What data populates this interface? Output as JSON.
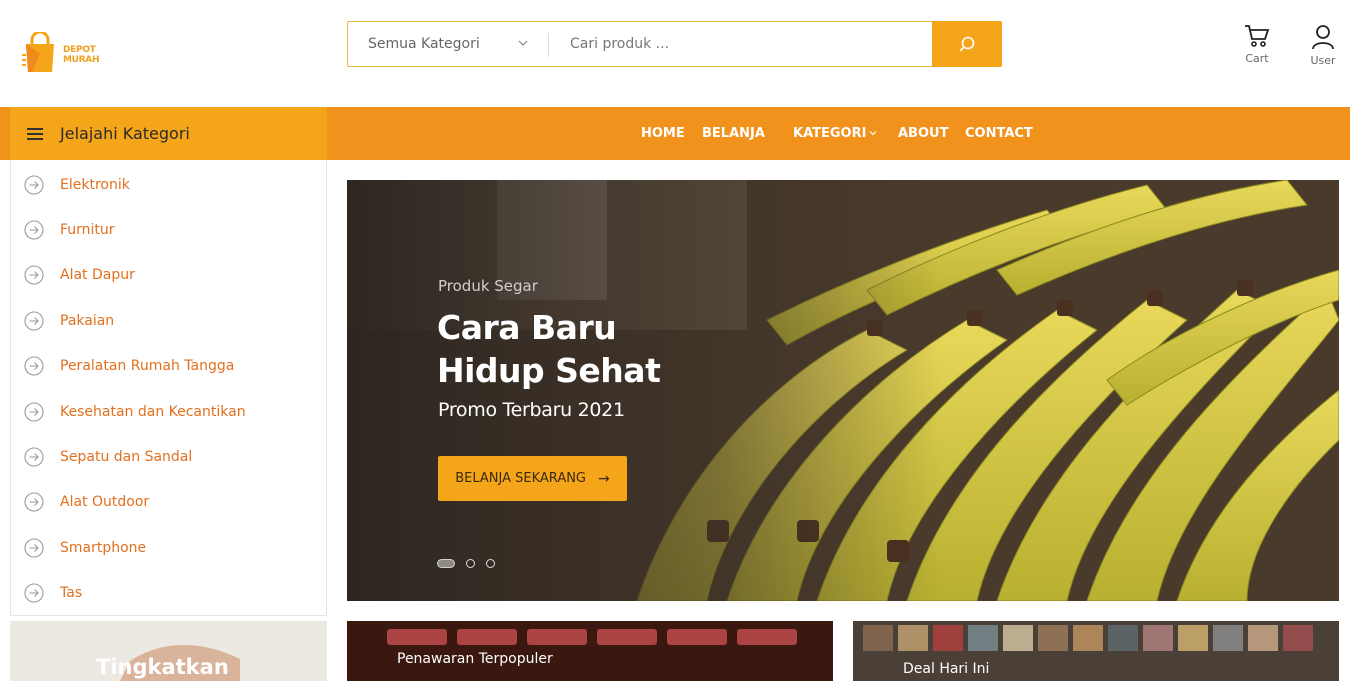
{
  "brand": {
    "logo_line1": "DEPOT",
    "logo_line2": "MURAH",
    "accent": "#f5a51a",
    "nav_color": "#f0921c",
    "link_color": "#e2701e"
  },
  "search": {
    "category_label": "Semua Kategori",
    "placeholder": "Cari produk ..."
  },
  "header": {
    "cart_label": "Cart",
    "user_label": "User"
  },
  "categories": {
    "toggle_label": "Jelajahi Kategori",
    "items": [
      "Elektronik",
      "Furnitur",
      "Alat Dapur",
      "Pakaian",
      "Peralatan Rumah Tangga",
      "Kesehatan dan Kecantikan",
      "Sepatu dan Sandal",
      "Alat Outdoor",
      "Smartphone",
      "Tas"
    ]
  },
  "nav": {
    "home": "HOME",
    "belanja": "BELANJA",
    "kategori": "KATEGORI",
    "about": "ABOUT",
    "contact": "CONTACT"
  },
  "hero": {
    "subtitle": "Produk Segar",
    "title_line1": "Cara Baru",
    "title_line2": "Hidup Sehat",
    "promo": "Promo Terbaru 2021",
    "button_label": "BELANJA SEKARANG",
    "button_arrow": "→",
    "slides_count": 3,
    "active_slide": 1
  },
  "banners": {
    "left_text": "Tingkatkan Imunitas",
    "middle_text": "Penawaran Terpopuler",
    "right_text": "Deal Hari Ini"
  }
}
